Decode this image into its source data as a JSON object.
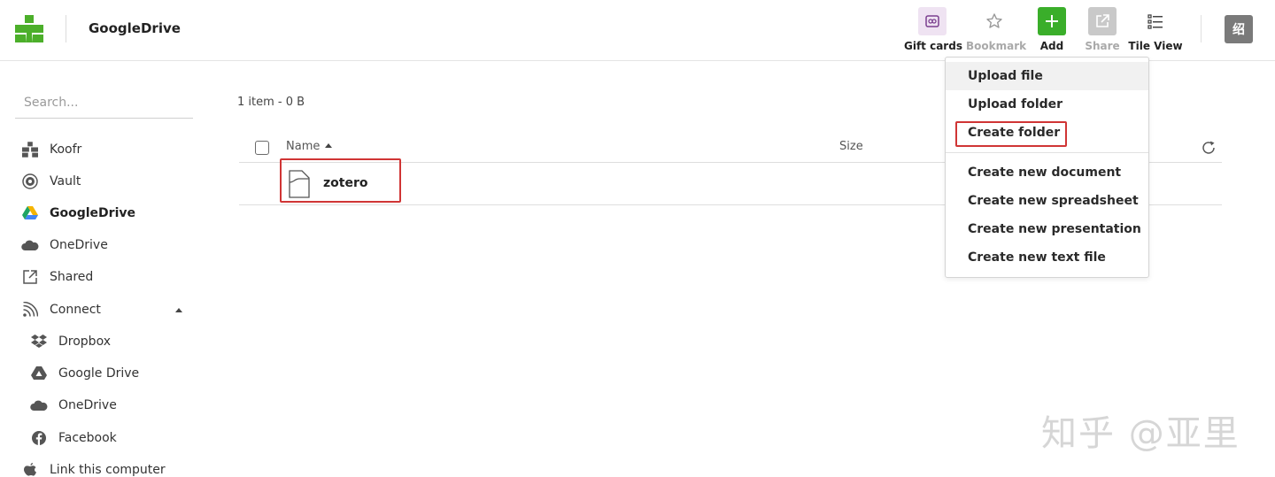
{
  "header": {
    "title": "GoogleDrive",
    "toolbar": {
      "gift_cards": "Gift cards",
      "bookmark": "Bookmark",
      "add": "Add",
      "share": "Share",
      "tile_view": "Tile View"
    },
    "avatar_text": "绍"
  },
  "sidebar": {
    "search_placeholder": "Search...",
    "items": [
      {
        "label": "Koofr",
        "icon": "koofr-icon"
      },
      {
        "label": "Vault",
        "icon": "vault-icon"
      },
      {
        "label": "GoogleDrive",
        "icon": "google-drive-icon"
      },
      {
        "label": "OneDrive",
        "icon": "onedrive-icon"
      },
      {
        "label": "Shared",
        "icon": "shared-icon"
      },
      {
        "label": "Connect",
        "icon": "rss-icon"
      }
    ],
    "connect_items": [
      {
        "label": "Dropbox",
        "icon": "dropbox-icon"
      },
      {
        "label": "Google Drive",
        "icon": "google-drive-icon"
      },
      {
        "label": "OneDrive",
        "icon": "onedrive-icon"
      },
      {
        "label": "Facebook",
        "icon": "facebook-icon"
      }
    ],
    "link_computer": "Link this computer"
  },
  "main": {
    "item_count": "1 item - 0 B",
    "columns": {
      "name": "Name",
      "size": "Size"
    },
    "files": [
      {
        "name": "zotero"
      }
    ]
  },
  "add_menu": {
    "items": [
      "Upload file",
      "Upload folder",
      "Create folder",
      "Create new document",
      "Create new spreadsheet",
      "Create new presentation",
      "Create new text file"
    ]
  },
  "watermark": "知乎 @亚里",
  "colors": {
    "brand_green": "#4caf2a",
    "add_green": "#3aae2a",
    "highlight_red": "#d03535",
    "gift_bg": "#efe3f2"
  }
}
